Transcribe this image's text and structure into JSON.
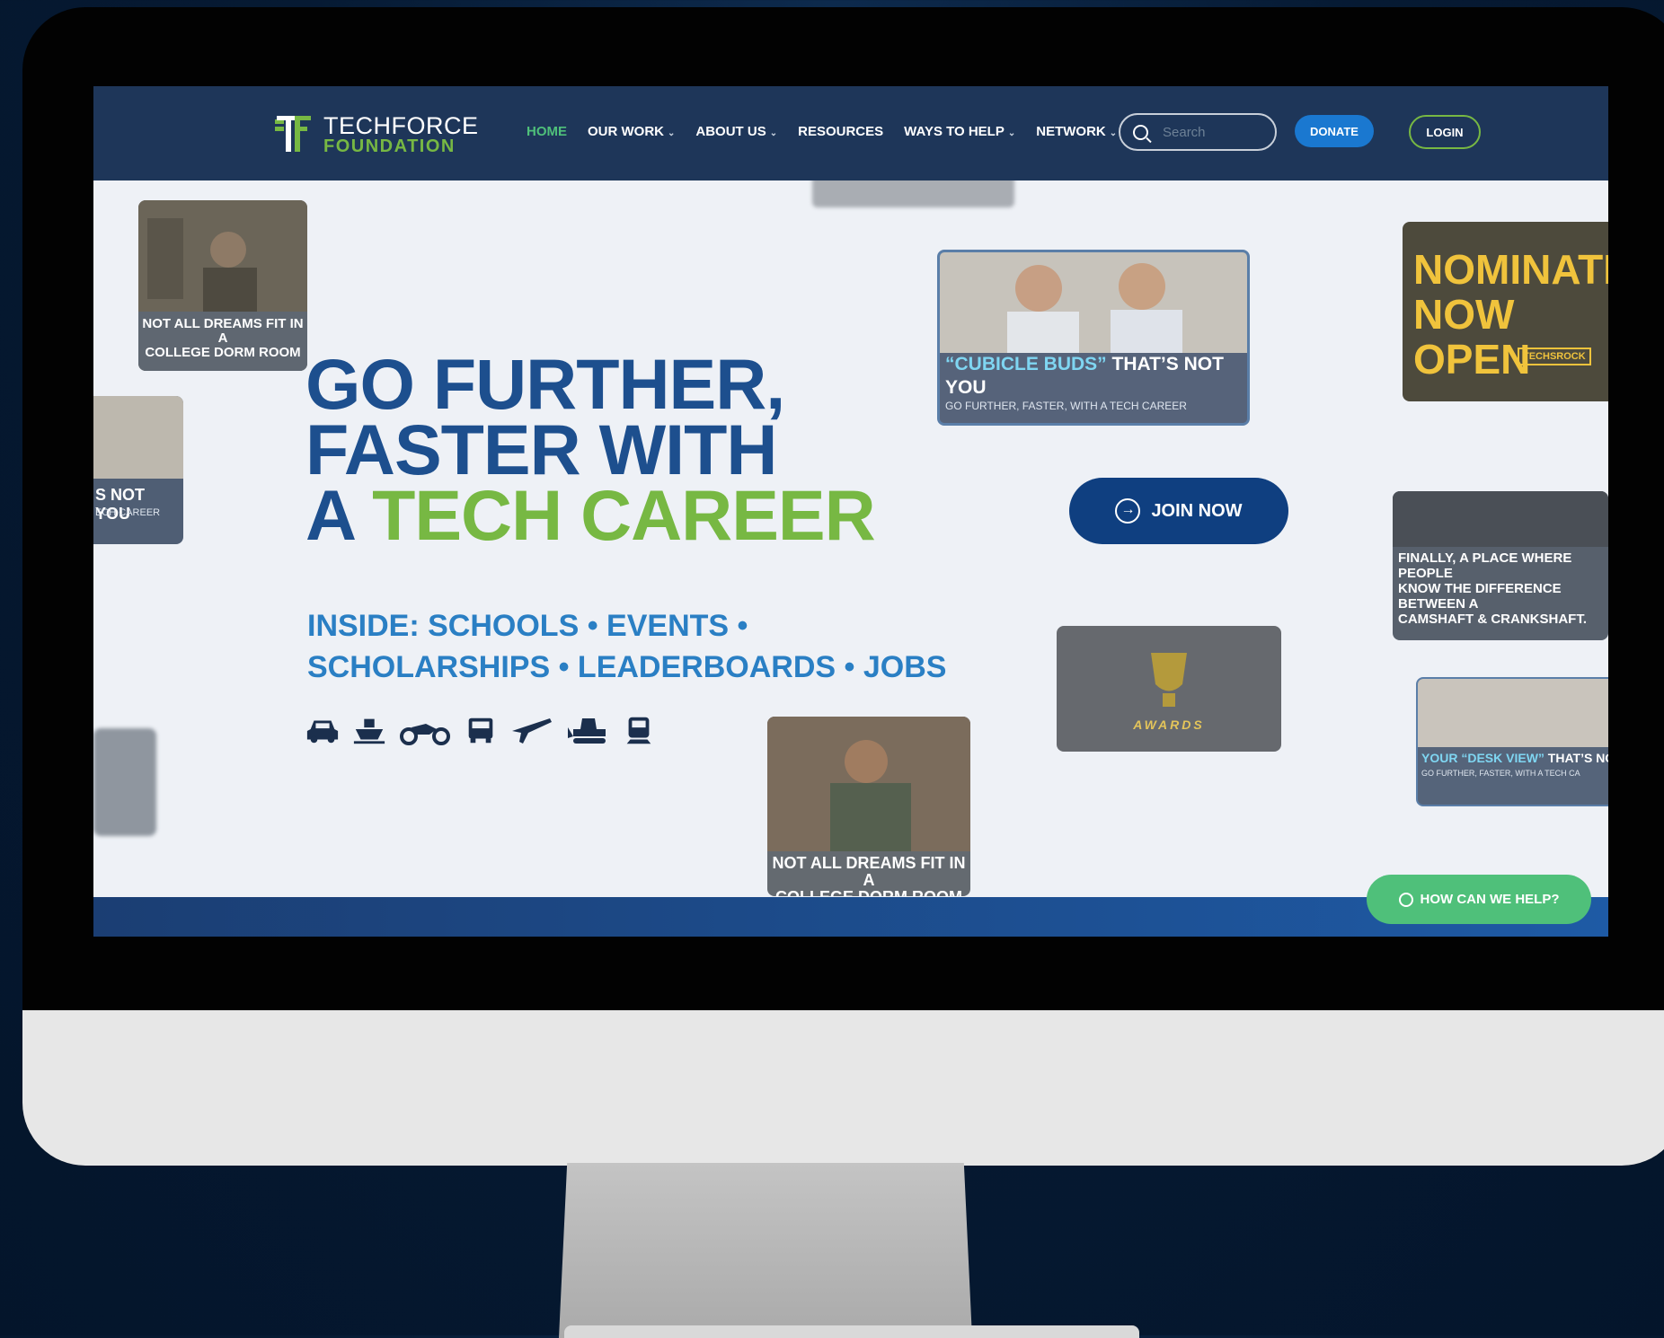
{
  "header": {
    "logo_line1": "TECHFORCE",
    "logo_line2": "FOUNDATION",
    "nav": [
      {
        "label": "HOME",
        "active": true,
        "dropdown": false
      },
      {
        "label": "OUR WORK",
        "active": false,
        "dropdown": true
      },
      {
        "label": "ABOUT US",
        "active": false,
        "dropdown": true
      },
      {
        "label": "RESOURCES",
        "active": false,
        "dropdown": false
      },
      {
        "label": "WAYS TO HELP",
        "active": false,
        "dropdown": true
      },
      {
        "label": "NETWORK",
        "active": false,
        "dropdown": true
      }
    ],
    "search_placeholder": "Search",
    "donate_label": "DONATE",
    "login_label": "LOGIN"
  },
  "hero": {
    "line1": "GO FURTHER,",
    "line2": "FASTER WITH",
    "line3_prefix": "A ",
    "line3_highlight": "TECH CAREER",
    "sub_line1": "INSIDE: SCHOOLS • EVENTS •",
    "sub_line2": "SCHOLARSHIPS • LEADERBOARDS • JOBS",
    "vehicle_icons": [
      "car-icon",
      "boat-icon",
      "motorcycle-icon",
      "truck-icon",
      "airplane-icon",
      "bulldozer-icon",
      "train-icon"
    ],
    "join_label": "JOIN NOW"
  },
  "cards": {
    "dorm_top": {
      "line1": "NOT ALL DREAMS FIT IN A",
      "line2": "COLLEGE DORM ROOM"
    },
    "cubicle": {
      "line1_highlight": "“CUBICLE BUDS”",
      "line1_rest": " THAT’S NOT YOU",
      "line2": "GO FURTHER, FASTER, WITH A TECH CAREER"
    },
    "nominations": {
      "line1": "NOMINATIONS",
      "line2": "NOW",
      "line3": "OPEN",
      "badge": "TECHSROCK"
    },
    "left_partial": {
      "line1": "S NOT YOU",
      "line2": "ECH CAREER"
    },
    "camshaft": {
      "line1": "FINALLY, A PLACE WHERE PEOPLE",
      "line2": "KNOW THE DIFFERENCE BETWEEN A",
      "line3": "CAMSHAFT & CRANKSHAFT."
    },
    "awards": {
      "label": "AWARDS"
    },
    "dorm_bottom": {
      "line1": "NOT ALL DREAMS FIT IN A",
      "line2": "COLLEGE DORM ROOM"
    },
    "desk": {
      "line1_highlight": "YOUR “DESK VIEW”",
      "line1_rest": " THAT’S NOT Y",
      "line2": "GO FURTHER, FASTER, WITH A TECH CA"
    }
  },
  "help_label": "HOW CAN WE HELP?",
  "colors": {
    "navy": "#1e3659",
    "blue": "#1d4f8e",
    "green": "#77b843",
    "accent_green": "#4fc07a"
  }
}
